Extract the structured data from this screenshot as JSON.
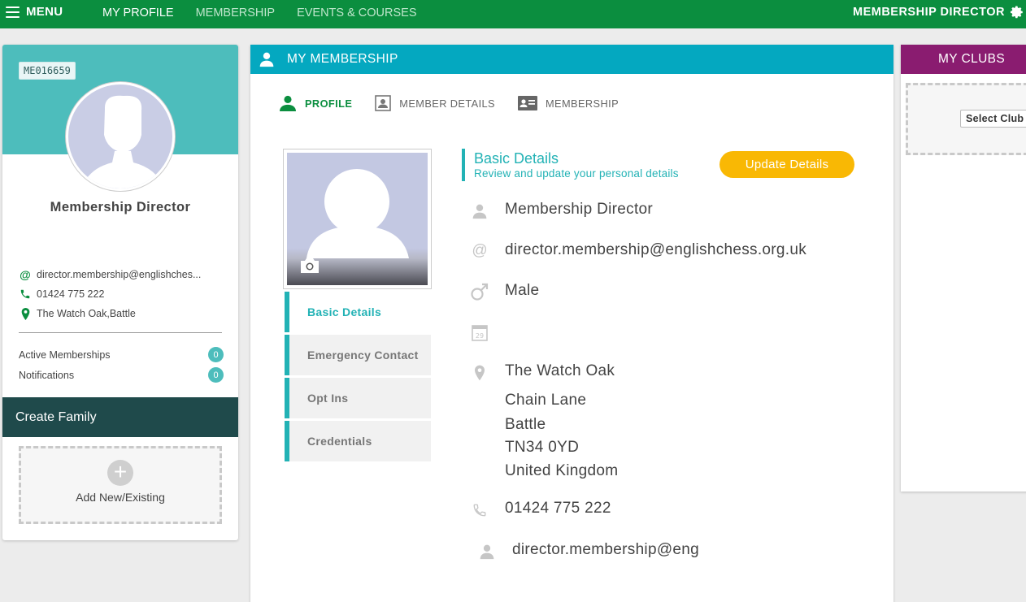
{
  "topbar": {
    "menu_label": "MENU",
    "nav": [
      "MY PROFILE",
      "MEMBERSHIP",
      "EVENTS & COURSES"
    ],
    "user_name": "MEMBERSHIP DIRECTOR",
    "user_icon": "gear-icon"
  },
  "profile_card": {
    "member_id": "ME016659",
    "name": "Membership Director",
    "email": "director.membership@englishches...",
    "phone": "01424 775 222",
    "address": "The Watch Oak,Battle",
    "stats": [
      {
        "label": "Active Memberships",
        "value": "0"
      },
      {
        "label": "Notifications",
        "value": "0"
      }
    ],
    "create_family_label": "Create Family",
    "add_new_label": "Add New/Existing"
  },
  "membership": {
    "title": "MY MEMBERSHIP",
    "tabs": [
      "PROFILE",
      "MEMBER DETAILS",
      "MEMBERSHIP"
    ],
    "side_nav": [
      "Basic Details",
      "Emergency Contact",
      "Opt Ins",
      "Credentials"
    ],
    "section_title": "Basic Details",
    "section_subtitle": "Review and update your personal details",
    "update_button": "Update Details",
    "details": {
      "name": "Membership Director",
      "email": "director.membership@englishchess.org.uk",
      "gender": "Male",
      "dob": "",
      "address": [
        "The Watch Oak",
        "Chain Lane",
        "Battle",
        "TN34 0YD",
        "United Kingdom"
      ],
      "phone": "01424 775 222",
      "username": "director.membership@eng"
    }
  },
  "clubs": {
    "title": "MY CLUBS",
    "select_placeholder": "Select Club"
  },
  "colors": {
    "topbar": "#0b8e3f",
    "teal": "#22b2b5",
    "membership_header": "#04a8c0",
    "clubs_header": "#8a1c70",
    "update_button": "#f9b804",
    "family_bar": "#1f4a4b"
  }
}
